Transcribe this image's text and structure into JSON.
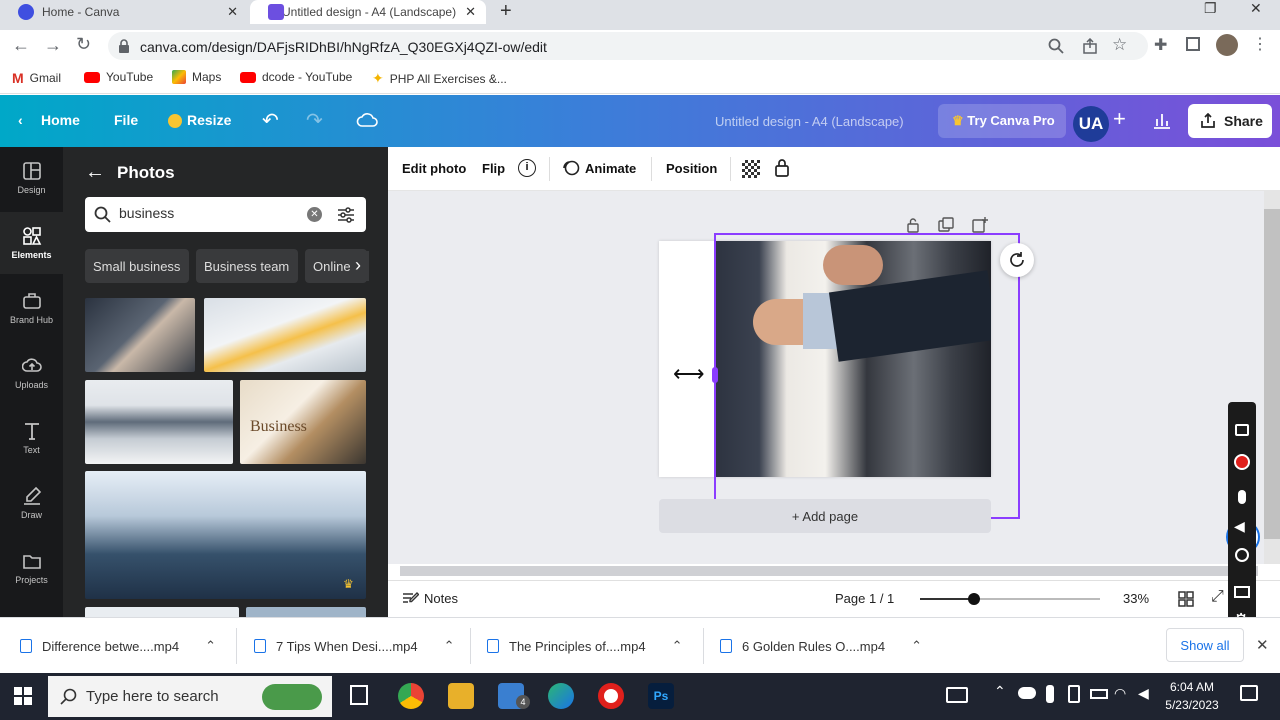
{
  "browser": {
    "tabs": [
      {
        "title": "Home - Canva",
        "active": false
      },
      {
        "title": "Untitled design - A4 (Landscape)",
        "active": true
      }
    ],
    "url": "canva.com/design/DAFjsRIDhBI/hNgRfzA_Q30EGXj4QZI-ow/edit",
    "bookmarks": [
      "Gmail",
      "YouTube",
      "Maps",
      "dcode - YouTube",
      "PHP All Exercises &..."
    ]
  },
  "header": {
    "home": "Home",
    "file": "File",
    "resize": "Resize",
    "doc_title": "Untitled design - A4 (Landscape)",
    "try_pro": "Try Canva Pro",
    "avatar": "UA",
    "share": "Share"
  },
  "rail": [
    {
      "label": "Design",
      "icon": "layout-icon"
    },
    {
      "label": "Elements",
      "icon": "shapes-icon",
      "active": true
    },
    {
      "label": "Brand Hub",
      "icon": "briefcase-icon"
    },
    {
      "label": "Uploads",
      "icon": "cloud-upload-icon"
    },
    {
      "label": "Text",
      "icon": "text-icon"
    },
    {
      "label": "Draw",
      "icon": "pen-icon"
    },
    {
      "label": "Projects",
      "icon": "folder-icon"
    }
  ],
  "panel": {
    "title": "Photos",
    "search_value": "business",
    "chips": [
      "Small business",
      "Business team",
      "Online b"
    ]
  },
  "toolbar": {
    "edit_photo": "Edit photo",
    "flip": "Flip",
    "animate": "Animate",
    "position": "Position"
  },
  "canvas": {
    "add_page": "+ Add page"
  },
  "footer": {
    "notes": "Notes",
    "page": "Page 1 / 1",
    "zoom": "33%",
    "zoom_fraction": 0.3
  },
  "downloads": {
    "items": [
      "Difference betwe....mp4",
      "7 Tips When Desi....mp4",
      "The Principles of....mp4",
      "6 Golden Rules O....mp4"
    ],
    "show_all": "Show all"
  },
  "taskbar": {
    "search_placeholder": "Type here to search",
    "time": "6:04 AM",
    "date": "5/23/2023",
    "mail_badge": "4"
  },
  "colors": {
    "selection": "#8b3dff",
    "header_start": "#00a8c8",
    "header_end": "#7a4fd9"
  }
}
